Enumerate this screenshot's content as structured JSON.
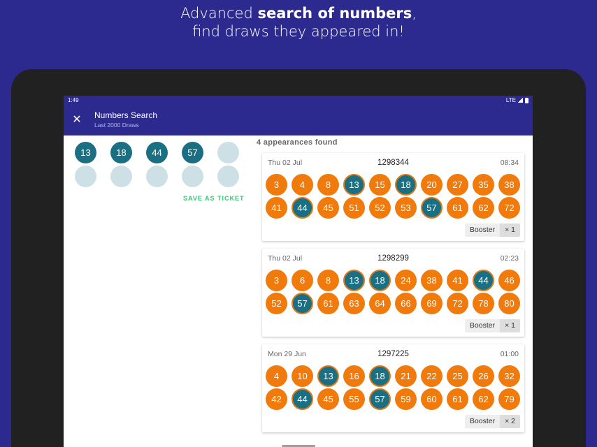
{
  "promo": {
    "line1_prefix": "Advanced ",
    "line1_bold": "search of numbers",
    "line1_suffix": ",",
    "line2": "find draws they appeared in!"
  },
  "statusbar": {
    "time": "1:49",
    "network": "LTE"
  },
  "appbar": {
    "close_icon": "close-icon",
    "title": "Numbers Search",
    "subtitle": "Last 2000 Draws"
  },
  "picked_numbers": [
    "13",
    "18",
    "44",
    "57",
    "",
    "",
    "",
    "",
    "",
    ""
  ],
  "save_label": "SAVE AS TICKET",
  "results_label": "4 appearances found",
  "draws": [
    {
      "date": "Thu 02 Jul",
      "number": "1298344",
      "time": "08:34",
      "balls": [
        "3",
        "4",
        "8",
        "13",
        "15",
        "18",
        "20",
        "27",
        "35",
        "38",
        "41",
        "44",
        "45",
        "51",
        "52",
        "53",
        "57",
        "61",
        "62",
        "72"
      ],
      "booster_label": "Booster",
      "booster_mult": "× 1"
    },
    {
      "date": "Thu 02 Jul",
      "number": "1298299",
      "time": "02:23",
      "balls": [
        "3",
        "6",
        "8",
        "13",
        "18",
        "24",
        "38",
        "41",
        "44",
        "46",
        "52",
        "57",
        "61",
        "63",
        "64",
        "66",
        "69",
        "72",
        "78",
        "80"
      ],
      "booster_label": "Booster",
      "booster_mult": "× 1"
    },
    {
      "date": "Mon 29 Jun",
      "number": "1297225",
      "time": "01:00",
      "balls": [
        "4",
        "10",
        "13",
        "16",
        "18",
        "21",
        "22",
        "25",
        "26",
        "32",
        "42",
        "44",
        "45",
        "55",
        "57",
        "59",
        "60",
        "61",
        "62",
        "79"
      ],
      "booster_label": "Booster",
      "booster_mult": "× 2"
    }
  ],
  "colors": {
    "brand": "#2d2a8f",
    "ball": "#f07a0c",
    "hit": "#1b6f82",
    "save": "#2ecc71"
  }
}
